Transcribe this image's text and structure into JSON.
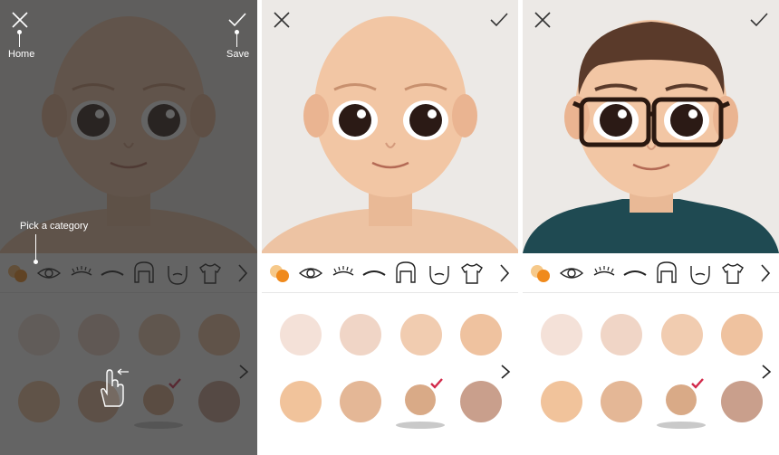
{
  "tutorial": {
    "home_label": "Home",
    "save_label": "Save",
    "category_hint": "Pick a category"
  },
  "toolbar": {
    "close_icon": "close-icon",
    "save_icon": "checkmark-icon"
  },
  "categories": [
    {
      "name": "skin-tone",
      "icon": "skin-tone-icon"
    },
    {
      "name": "eyes",
      "icon": "eye-icon"
    },
    {
      "name": "eyelashes",
      "icon": "eyelashes-icon"
    },
    {
      "name": "eyebrows",
      "icon": "eyebrow-icon"
    },
    {
      "name": "hair",
      "icon": "hair-icon"
    },
    {
      "name": "beard",
      "icon": "beard-icon"
    },
    {
      "name": "clothing",
      "icon": "tshirt-icon"
    },
    {
      "name": "more",
      "icon": "chevron-right-icon"
    }
  ],
  "skin_swatches": {
    "colors": [
      "#f4e1d8",
      "#f0d5c6",
      "#f1ccb0",
      "#efc29f",
      "#f1c39b",
      "#e4b796",
      "#d9aa87",
      "#c99f8c"
    ],
    "selected_index": 6,
    "accent_color": "#d22b4b"
  },
  "screens": [
    {
      "state": "tutorial-overlay",
      "avatar": "bald-shirtless"
    },
    {
      "state": "default",
      "avatar": "bald-shirtless"
    },
    {
      "state": "customized",
      "avatar": "short-hair-glasses-teal-shirt"
    }
  ]
}
